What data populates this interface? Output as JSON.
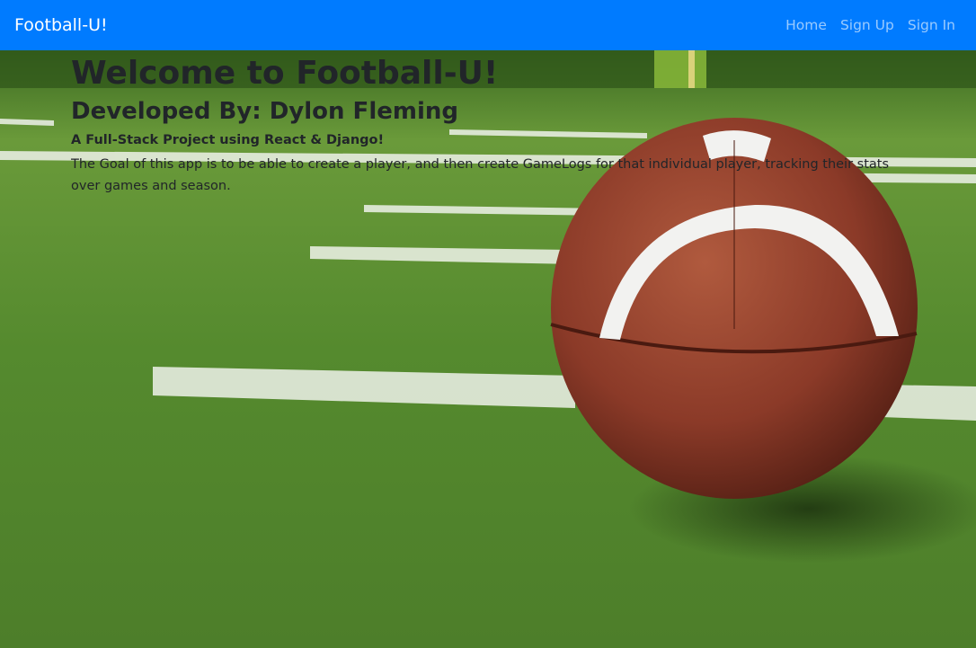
{
  "navbar": {
    "brand": "Football-U!",
    "links": [
      "Home",
      "Sign Up",
      "Sign In"
    ]
  },
  "hero": {
    "title": "Welcome to Football-U!",
    "subtitle": "Developed By: Dylon Fleming",
    "tagline": "A Full-Stack Project using React & Django!",
    "description": "The Goal of this app is to be able to create a player, and then create GameLogs for that individual player, tracking their stats over games and season."
  },
  "colors": {
    "navbar": "#007bff",
    "text": "#212529",
    "grass": "#4a7a2a",
    "football": "#8b3a28"
  }
}
